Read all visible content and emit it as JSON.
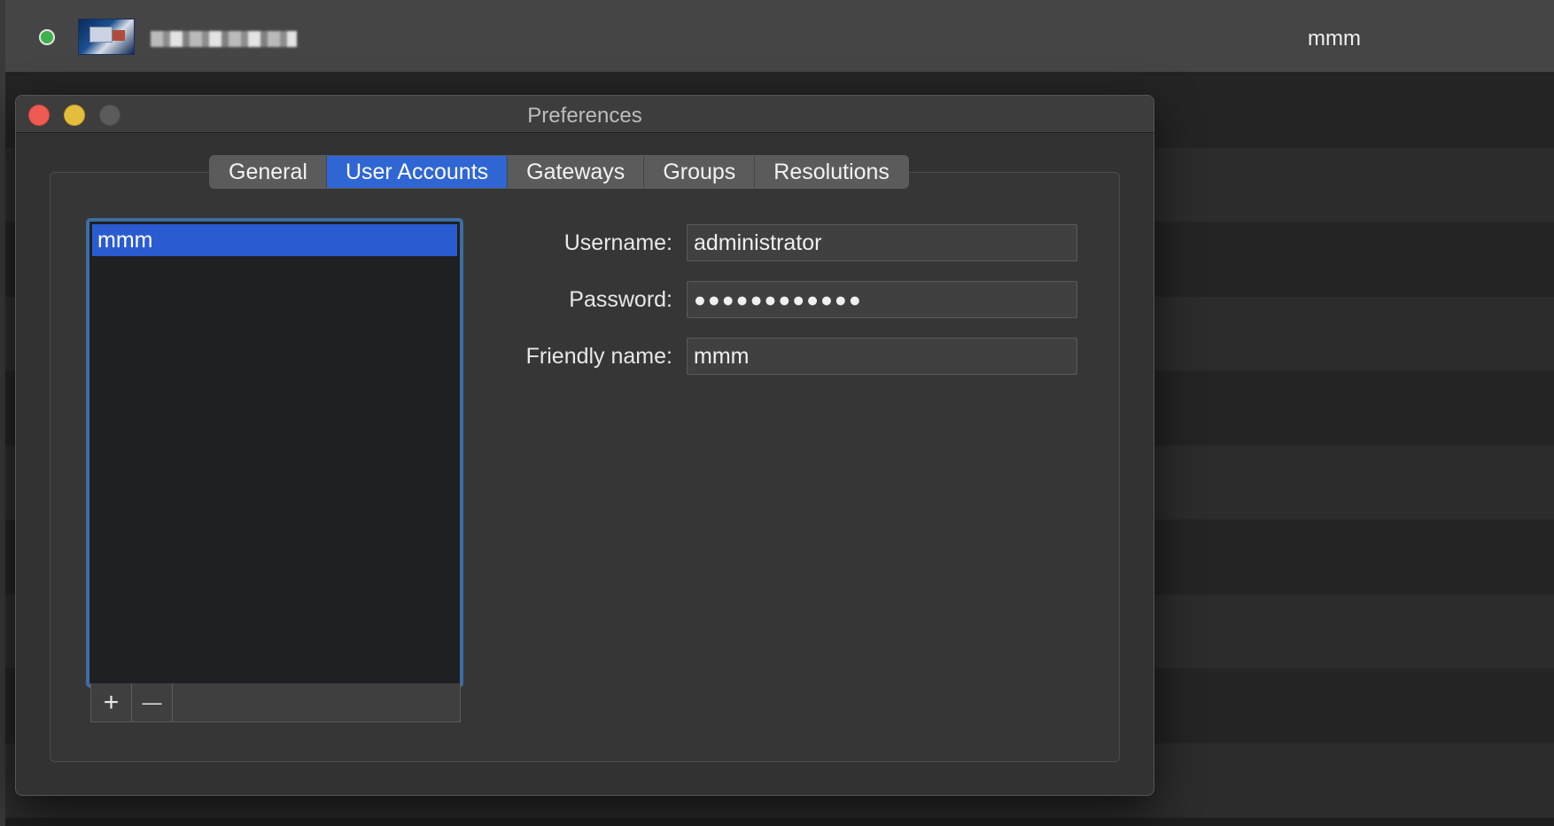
{
  "background_app": {
    "status_color": "#3db14e",
    "session_name": "mmm"
  },
  "window": {
    "title": "Preferences",
    "traffic_lights": {
      "close_color": "#ee5b52",
      "minimize_color": "#e5bd3d",
      "zoom_color": "#5b5b5b"
    }
  },
  "tabs": [
    {
      "label": "General",
      "active": false
    },
    {
      "label": "User Accounts",
      "active": true
    },
    {
      "label": "Gateways",
      "active": false
    },
    {
      "label": "Groups",
      "active": false
    },
    {
      "label": "Resolutions",
      "active": false
    }
  ],
  "user_list": {
    "items": [
      {
        "label": "mmm",
        "selected": true
      }
    ],
    "add_label": "+",
    "remove_label": "—"
  },
  "form": {
    "username_label": "Username:",
    "username_value": "administrator",
    "password_label": "Password:",
    "password_value": "●●●●●●●●●●●●",
    "friendly_label": "Friendly name:",
    "friendly_value": "mmm"
  },
  "accent_color": "#2f66d4"
}
